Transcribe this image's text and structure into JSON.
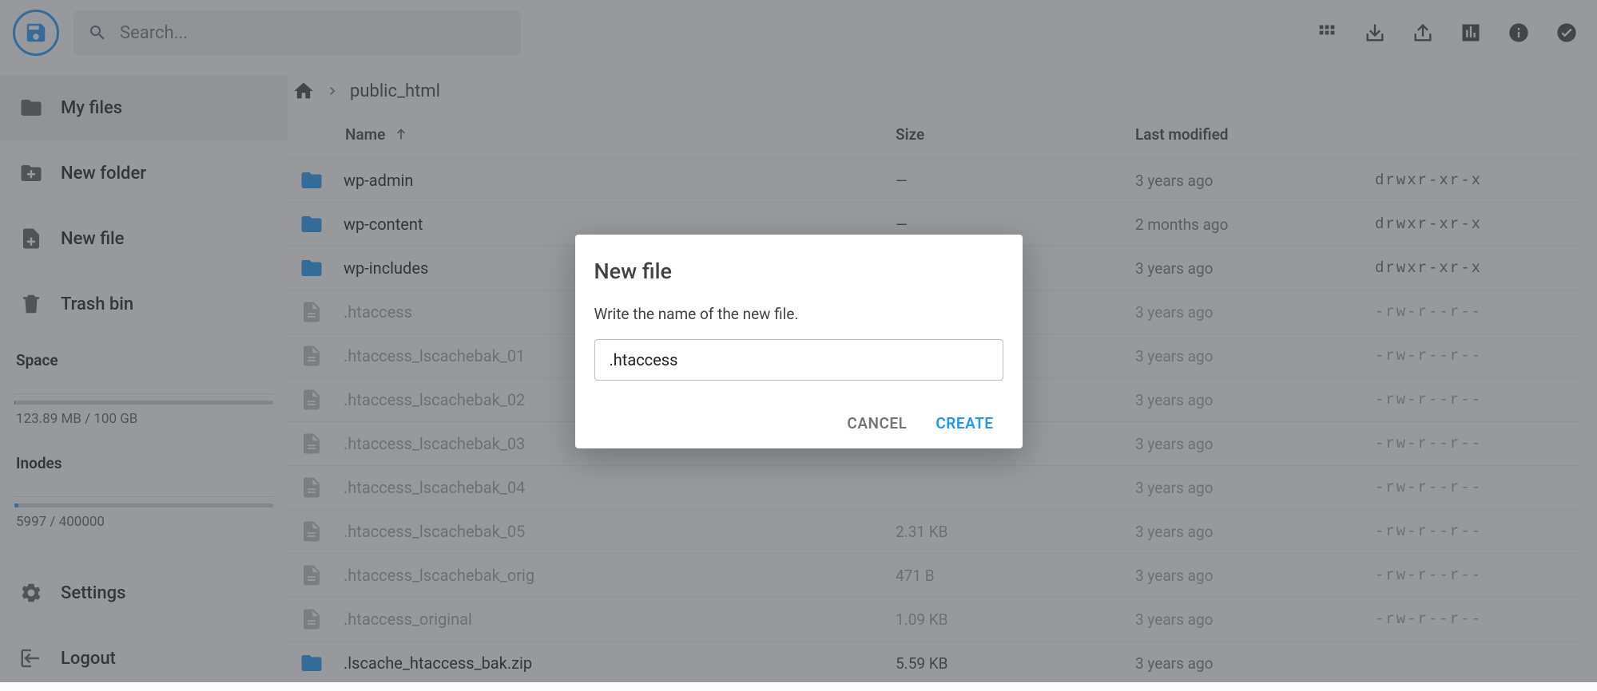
{
  "search": {
    "placeholder": "Search..."
  },
  "sidebar": {
    "items": [
      {
        "label": "My files"
      },
      {
        "label": "New folder"
      },
      {
        "label": "New file"
      },
      {
        "label": "Trash bin"
      }
    ],
    "space_label": "Space",
    "space_value": "123.89 MB / 100 GB",
    "space_percent": 0.12,
    "inodes_label": "Inodes",
    "inodes_value": "5997 / 400000",
    "inodes_percent": 1.5,
    "settings": "Settings",
    "logout": "Logout"
  },
  "breadcrumb": {
    "current": "public_html"
  },
  "columns": {
    "name": "Name",
    "size": "Size",
    "modified": "Last modified"
  },
  "rows": [
    {
      "type": "folder",
      "name": "wp-admin",
      "size": "—",
      "modified": "3 years ago",
      "perm": "drwxr-xr-x"
    },
    {
      "type": "folder",
      "name": "wp-content",
      "size": "—",
      "modified": "2 months ago",
      "perm": "drwxr-xr-x"
    },
    {
      "type": "folder",
      "name": "wp-includes",
      "size": "",
      "modified": "3 years ago",
      "perm": "drwxr-xr-x"
    },
    {
      "type": "file",
      "name": ".htaccess",
      "size": "",
      "modified": "3 years ago",
      "perm": "-rw-r--r--"
    },
    {
      "type": "file",
      "name": ".htaccess_lscachebak_01",
      "size": "",
      "modified": "3 years ago",
      "perm": "-rw-r--r--"
    },
    {
      "type": "file",
      "name": ".htaccess_lscachebak_02",
      "size": "",
      "modified": "3 years ago",
      "perm": "-rw-r--r--"
    },
    {
      "type": "file",
      "name": ".htaccess_lscachebak_03",
      "size": "",
      "modified": "3 years ago",
      "perm": "-rw-r--r--"
    },
    {
      "type": "file",
      "name": ".htaccess_lscachebak_04",
      "size": "",
      "modified": "3 years ago",
      "perm": "-rw-r--r--"
    },
    {
      "type": "file",
      "name": ".htaccess_lscachebak_05",
      "size": "2.31 KB",
      "modified": "3 years ago",
      "perm": "-rw-r--r--"
    },
    {
      "type": "file",
      "name": ".htaccess_lscachebak_orig",
      "size": "471 B",
      "modified": "3 years ago",
      "perm": "-rw-r--r--"
    },
    {
      "type": "file",
      "name": ".htaccess_original",
      "size": "1.09 KB",
      "modified": "3 years ago",
      "perm": "-rw-r--r--"
    },
    {
      "type": "folder-dim",
      "name": ".lscache_htaccess_bak.zip",
      "size": "5.59 KB",
      "modified": "3 years ago",
      "perm": ""
    }
  ],
  "dialog": {
    "title": "New file",
    "prompt": "Write the name of the new file.",
    "input_value": ".htaccess",
    "cancel": "CANCEL",
    "create": "CREATE"
  }
}
